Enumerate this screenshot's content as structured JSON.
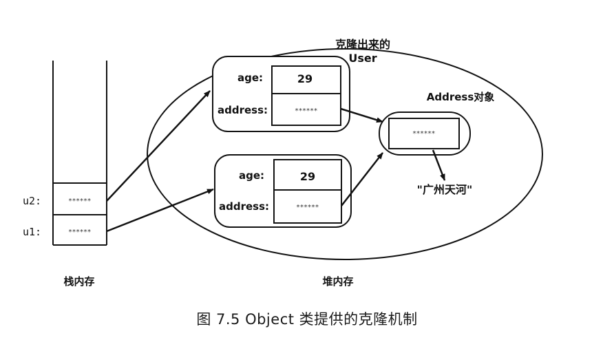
{
  "stack": {
    "label": "栈内存",
    "slots": [
      {
        "var": "u2:",
        "value": "******"
      },
      {
        "var": "u1:",
        "value": "******"
      }
    ]
  },
  "heap": {
    "label": "堆内存",
    "clone_label_line1": "克隆出来的",
    "clone_label_line2": "User",
    "user_top": {
      "age_key": "age:",
      "age_value": "29",
      "address_key": "address:",
      "address_value": "******"
    },
    "user_bottom": {
      "age_key": "age:",
      "age_value": "29",
      "address_key": "address:",
      "address_value": "******"
    },
    "address_object": {
      "label": "Address对象",
      "value": "******"
    },
    "string_value": "\"广州天河\""
  },
  "caption": "图 7.5    Object 类提供的克隆机制"
}
